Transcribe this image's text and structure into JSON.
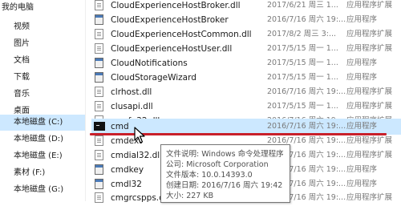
{
  "sidebar": {
    "items": [
      {
        "label": "我的电脑",
        "selected": false
      },
      {
        "label": "视频",
        "selected": false
      },
      {
        "label": "图片",
        "selected": false
      },
      {
        "label": "文档",
        "selected": false
      },
      {
        "label": "下载",
        "selected": false
      },
      {
        "label": "音乐",
        "selected": false
      },
      {
        "label": "桌面",
        "selected": false
      },
      {
        "label": "本地磁盘 (C:)",
        "selected": true
      },
      {
        "label": "本地磁盘 (D:)",
        "selected": false
      },
      {
        "label": "本地磁盘 (E:)",
        "selected": false
      },
      {
        "label": "素材 (F:)",
        "selected": false
      },
      {
        "label": "本地磁盘 (G:)",
        "selected": false
      }
    ]
  },
  "files": [
    {
      "name": "CloudExperienceHostBroker.dll",
      "date": "2017/6/21 周三 1...",
      "type": "应用程序扩展",
      "icon": "dll-file-icon"
    },
    {
      "name": "CloudExperienceHostBroker",
      "date": "2016/7/16 周六 19:...",
      "type": "应用程序",
      "icon": "exe-file-icon"
    },
    {
      "name": "CloudExperienceHostCommon.dll",
      "date": "2017/8/2 周三 3:...",
      "type": "应用程序扩展",
      "icon": "dll-file-icon"
    },
    {
      "name": "CloudExperienceHostUser.dll",
      "date": "2017/5/15 周一 1...",
      "type": "应用程序扩展",
      "icon": "dll-file-icon"
    },
    {
      "name": "CloudNotifications",
      "date": "2017/5/15 周一 1...",
      "type": "应用程序",
      "icon": "exe-file-icon"
    },
    {
      "name": "CloudStorageWizard",
      "date": "2017/5/15 周一 1...",
      "type": "应用程序",
      "icon": "exe-file-icon"
    },
    {
      "name": "clrhost.dll",
      "date": "2016/7/16 周六 19:...",
      "type": "应用程序扩展",
      "icon": "dll-file-icon"
    },
    {
      "name": "clusapi.dll",
      "date": "2017/5/15 周一 1...",
      "type": "应用程序扩展",
      "icon": "dll-file-icon"
    },
    {
      "name": "cmcfg32.dll",
      "date": "2016/7/16 周六 19:...",
      "type": "应用程序扩展",
      "icon": "dll-file-icon"
    },
    {
      "name": "cmd",
      "date": "2016/7/16 周六 19:...",
      "type": "应用程序",
      "icon": "console-icon"
    },
    {
      "name": "cmdext",
      "date": "2016/7/16 周六 19:...",
      "type": "应用程序扩展",
      "icon": "dll-file-icon"
    },
    {
      "name": "cmdial32.dll",
      "date": "2016/7/16 周六 19:...",
      "type": "应用程序扩展",
      "icon": "dll-file-icon"
    },
    {
      "name": "cmdkey",
      "date": "2016/7/16 周六 19:...",
      "type": "应用程序",
      "icon": "exe-file-icon"
    },
    {
      "name": "cmdl32",
      "date": "2016/7/16 周六 19:...",
      "type": "应用程序",
      "icon": "exe-file-icon"
    },
    {
      "name": "cmgrcspps.dll",
      "date": "2016/7/16 周六 19:...",
      "type": "应用程序扩展",
      "icon": "dll-file-icon"
    }
  ],
  "tooltip": {
    "description": "文件说明: Windows 命令处理程序",
    "company": "公司: Microsoft Corporation",
    "version": "文件版本: 10.0.14393.0",
    "created": "创建日期: 2016/7/16 周六 19:42",
    "size": "大小: 227 KB"
  },
  "colors": {
    "selection": "#cce8ff",
    "annotation_line": "#c8202a",
    "secondary_text": "#7a7a7a"
  }
}
